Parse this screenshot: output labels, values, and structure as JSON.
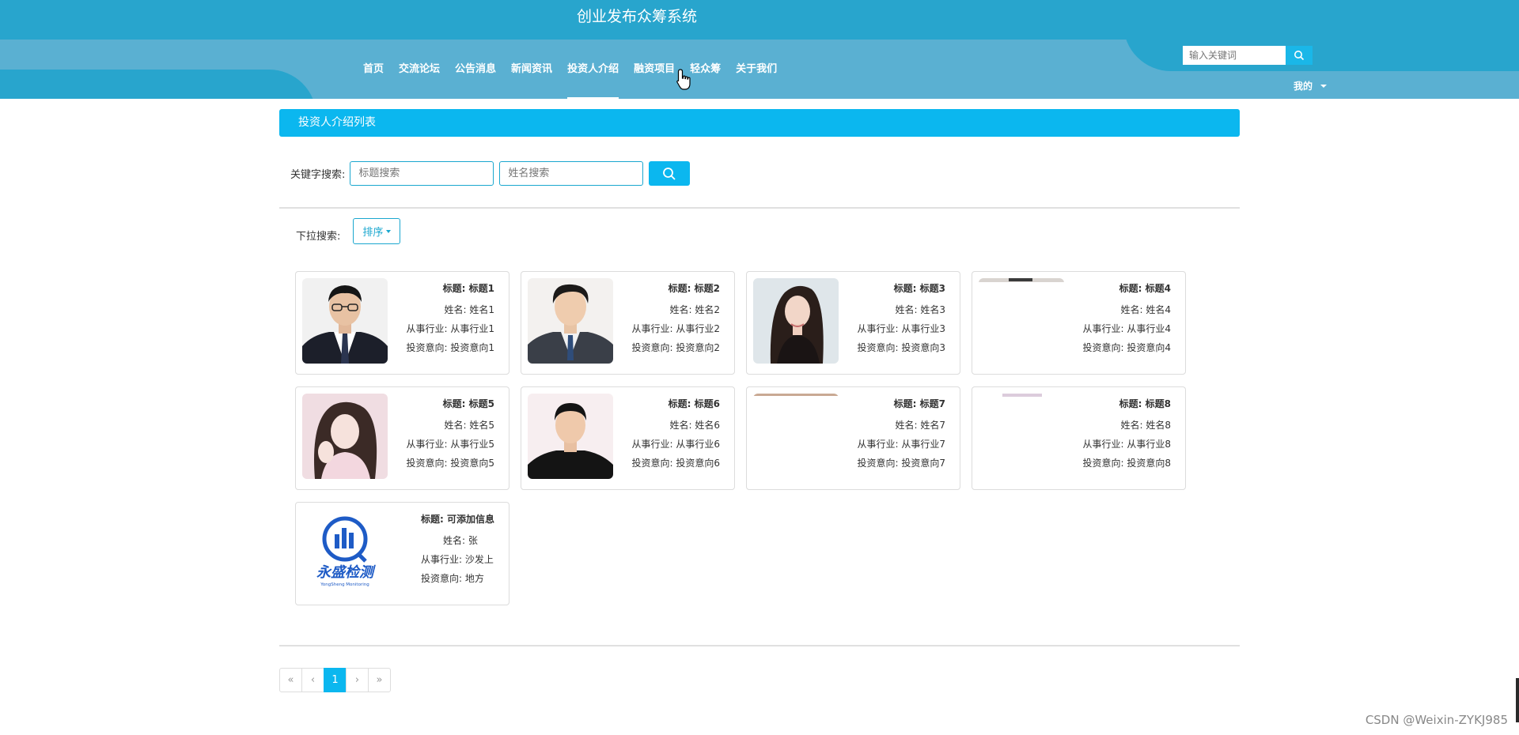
{
  "header": {
    "title": "创业发布众筹系统",
    "search_placeholder": "输入关键词",
    "mine_label": "我的"
  },
  "nav": [
    {
      "label": "首页",
      "active": false
    },
    {
      "label": "交流论坛",
      "active": false
    },
    {
      "label": "公告消息",
      "active": false
    },
    {
      "label": "新闻资讯",
      "active": false
    },
    {
      "label": "投资人介绍",
      "active": true
    },
    {
      "label": "融资项目",
      "active": false
    },
    {
      "label": "轻众筹",
      "active": false
    },
    {
      "label": "关于我们",
      "active": false
    }
  ],
  "banner": {
    "title": "投资人介绍列表"
  },
  "search": {
    "keyword_label": "关键字搜索:",
    "title_placeholder": "标题搜索",
    "name_placeholder": "姓名搜索",
    "dropdown_label": "下拉搜索:",
    "sort_label": "排序"
  },
  "field_labels": {
    "title": "标题:",
    "name": "姓名:",
    "industry": "从事行业:",
    "intent": "投资意向:"
  },
  "cards": [
    {
      "title": "标题1",
      "name": "姓名1",
      "industry": "从事行业1",
      "intent": "投资意向1",
      "photo": "man-suit-glasses-photo"
    },
    {
      "title": "标题2",
      "name": "姓名2",
      "industry": "从事行业2",
      "intent": "投资意向2",
      "photo": "man-suit-photo"
    },
    {
      "title": "标题3",
      "name": "姓名3",
      "industry": "从事行业3",
      "intent": "投资意向3",
      "photo": "woman-portrait-photo"
    },
    {
      "title": "标题4",
      "name": "姓名4",
      "industry": "从事行业4",
      "intent": "投资意向4",
      "photo": "blank-photo"
    },
    {
      "title": "标题5",
      "name": "姓名5",
      "industry": "从事行业5",
      "intent": "投资意向5",
      "photo": "woman-pink-photo"
    },
    {
      "title": "标题6",
      "name": "姓名6",
      "industry": "从事行业6",
      "intent": "投资意向6",
      "photo": "man-black-shirt-photo"
    },
    {
      "title": "标题7",
      "name": "姓名7",
      "industry": "从事行业7",
      "intent": "投资意向7",
      "photo": "blank-photo"
    },
    {
      "title": "标题8",
      "name": "姓名8",
      "industry": "从事行业8",
      "intent": "投资意向8",
      "photo": "blank-photo"
    },
    {
      "title": "可添加信息",
      "name": "张",
      "industry": "沙发上",
      "intent": "地方",
      "photo": "logo-image"
    }
  ],
  "logo": {
    "text": "永盛检测",
    "subtext": "YongSheng Monitoring"
  },
  "pagination": {
    "first": "«",
    "prev": "‹",
    "current": "1",
    "next": "›",
    "last": "»"
  },
  "watermark": "CSDN @Weixin-ZYKJ985",
  "colors": {
    "header_dark": "#28a5cd",
    "header_light": "#5ab0d2",
    "accent": "#0bb7ef"
  }
}
